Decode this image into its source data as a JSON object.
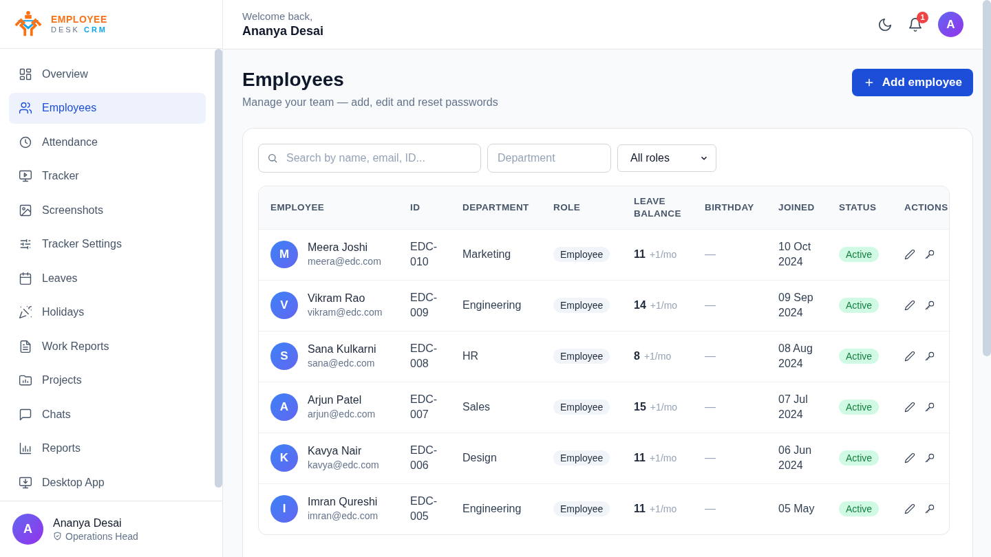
{
  "brand": {
    "line1": "EMPLOYEE",
    "line2a": "DESK",
    "line2b": "CRM"
  },
  "nav": [
    {
      "label": "Overview",
      "selected": false
    },
    {
      "label": "Employees",
      "selected": true
    },
    {
      "label": "Attendance",
      "selected": false
    },
    {
      "label": "Tracker",
      "selected": false
    },
    {
      "label": "Screenshots",
      "selected": false
    },
    {
      "label": "Tracker Settings",
      "selected": false
    },
    {
      "label": "Leaves",
      "selected": false
    },
    {
      "label": "Holidays",
      "selected": false
    },
    {
      "label": "Work Reports",
      "selected": false
    },
    {
      "label": "Projects",
      "selected": false
    },
    {
      "label": "Chats",
      "selected": false
    },
    {
      "label": "Reports",
      "selected": false
    },
    {
      "label": "Desktop App",
      "selected": false
    }
  ],
  "user": {
    "initial": "A",
    "name": "Ananya Desai",
    "role": "Operations Head"
  },
  "header": {
    "welcome": "Welcome back,",
    "name": "Ananya Desai",
    "notifications": "1",
    "avatar": "A"
  },
  "page": {
    "title": "Employees",
    "subtitle": "Manage your team — add, edit and reset passwords",
    "add_button": "Add employee"
  },
  "filters": {
    "search_placeholder": "Search by name, email, ID...",
    "department_placeholder": "Department",
    "role_value": "All roles"
  },
  "table": {
    "columns": [
      "EMPLOYEE",
      "ID",
      "DEPARTMENT",
      "ROLE",
      "LEAVE BALANCE",
      "BIRTHDAY",
      "JOINED",
      "STATUS",
      "ACTIONS"
    ],
    "rows": [
      {
        "initial": "M",
        "name": "Meera Joshi",
        "email": "meera@edc.com",
        "id": "EDC-010",
        "department": "Marketing",
        "role": "Employee",
        "leave": "11",
        "accrual": "+1/mo",
        "birthday": "—",
        "joined": "10 Oct 2024",
        "status": "Active"
      },
      {
        "initial": "V",
        "name": "Vikram Rao",
        "email": "vikram@edc.com",
        "id": "EDC-009",
        "department": "Engineering",
        "role": "Employee",
        "leave": "14",
        "accrual": "+1/mo",
        "birthday": "—",
        "joined": "09 Sep 2024",
        "status": "Active"
      },
      {
        "initial": "S",
        "name": "Sana Kulkarni",
        "email": "sana@edc.com",
        "id": "EDC-008",
        "department": "HR",
        "role": "Employee",
        "leave": "8",
        "accrual": "+1/mo",
        "birthday": "—",
        "joined": "08 Aug 2024",
        "status": "Active"
      },
      {
        "initial": "A",
        "name": "Arjun Patel",
        "email": "arjun@edc.com",
        "id": "EDC-007",
        "department": "Sales",
        "role": "Employee",
        "leave": "15",
        "accrual": "+1/mo",
        "birthday": "—",
        "joined": "07 Jul 2024",
        "status": "Active"
      },
      {
        "initial": "K",
        "name": "Kavya Nair",
        "email": "kavya@edc.com",
        "id": "EDC-006",
        "department": "Design",
        "role": "Employee",
        "leave": "11",
        "accrual": "+1/mo",
        "birthday": "—",
        "joined": "06 Jun 2024",
        "status": "Active"
      },
      {
        "initial": "I",
        "name": "Imran Qureshi",
        "email": "imran@edc.com",
        "id": "EDC-005",
        "department": "Engineering",
        "role": "Employee",
        "leave": "11",
        "accrual": "+1/mo",
        "birthday": "—",
        "joined": "05 May",
        "status": "Active"
      }
    ]
  }
}
